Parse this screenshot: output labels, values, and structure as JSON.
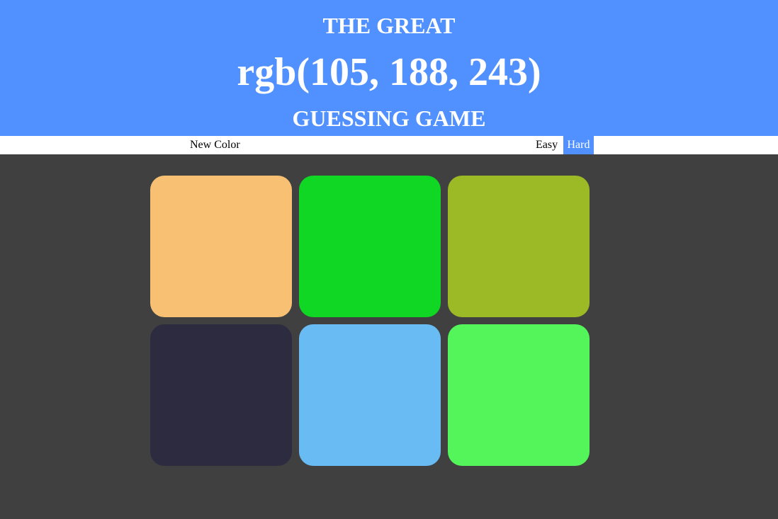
{
  "header": {
    "title_top": "THE GREAT",
    "target_color": "rgb(105, 188, 243)",
    "title_bottom": "GUESSING GAME",
    "background": "#5190FF"
  },
  "controls": {
    "new_color_label": "New Color",
    "message": "",
    "easy_label": "Easy",
    "hard_label": "Hard",
    "selected_mode": "Hard"
  },
  "squares": [
    {
      "color": "#F7C072"
    },
    {
      "color": "#0FD724"
    },
    {
      "color": "#9BBA25"
    },
    {
      "color": "#2D2B40"
    },
    {
      "color": "#69BCF3"
    },
    {
      "color": "#53F55A"
    }
  ],
  "page_background": "#404040"
}
